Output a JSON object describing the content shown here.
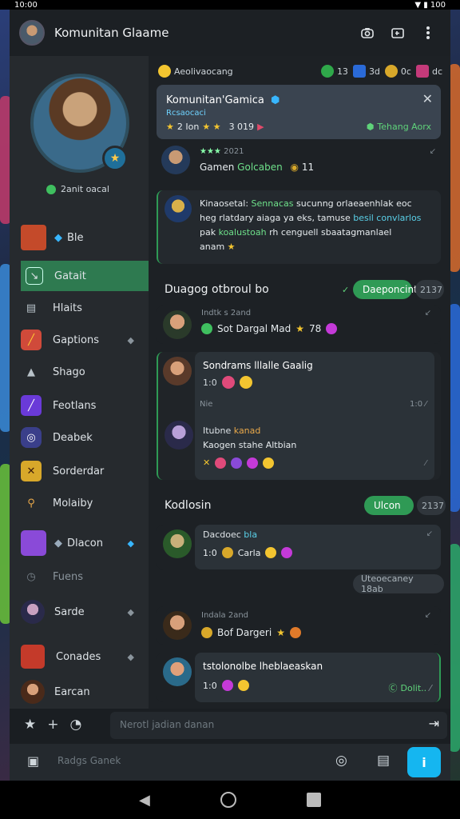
{
  "status_bar": {
    "time": "10:00",
    "battery": "100"
  },
  "header": {
    "title": "Komunitan Glaame"
  },
  "profile": {
    "status_text": "2anit oacal"
  },
  "sidebar": {
    "items": [
      {
        "label": "Ble",
        "icon": "diamond-icon"
      },
      {
        "label": "Gatait",
        "icon": "chat-icon"
      },
      {
        "label": "Hlaits",
        "icon": "cards-icon"
      },
      {
        "label": "Gaptions",
        "icon": "sword-icon"
      },
      {
        "label": "Shago",
        "icon": "pyramid-icon"
      },
      {
        "label": "Feotlans",
        "icon": "quill-icon"
      },
      {
        "label": "Deabek",
        "icon": "game-icon"
      },
      {
        "label": "Sorderdar",
        "icon": "crossed-swords-icon"
      },
      {
        "label": "Molaiby",
        "icon": "magnifier-icon"
      },
      {
        "label": "Dlacon",
        "icon": "gem-icon"
      },
      {
        "label": "Fuens",
        "icon": "clock-icon"
      },
      {
        "label": "Sarde",
        "icon": "avatar-icon"
      },
      {
        "label": "Conades",
        "icon": "cards-icon"
      },
      {
        "label": "Earcan",
        "icon": "avatar-icon"
      }
    ]
  },
  "main": {
    "top_chips": {
      "label": "Aeolivaocang",
      "c1": "13",
      "c2": "3d",
      "c3": "0c",
      "c4": "dc"
    },
    "group_card": {
      "name": "Komunitan'Gamica",
      "sub": "Rcsaocaci",
      "rating": "2 Ion",
      "count": "3 019",
      "tag": "Tehang Aorx"
    },
    "m1": {
      "stars": "2021",
      "text": "Gamen",
      "highlight": "Golcaben",
      "count": "11"
    },
    "m2": {
      "lead": "Kinaosetal:",
      "hl1": "Sennacas",
      "rest1": "sucunng orlaeaenhlak eoc",
      "line2": "heg rlatdary aiaga ya eks, tamuse",
      "hl2": "besil convlarlos",
      "line3a": "pak",
      "hl3": "koalustoah",
      "line3b": "rh cenguell sbaatagmanlael",
      "line4": "anam"
    },
    "section1": {
      "title": "Duagog otbroul bo",
      "bubble": "Daeponcint",
      "time": "2137"
    },
    "m3": {
      "meta": "Indtk s 2and",
      "text": "Sot Dargal Mad",
      "count": "78"
    },
    "m4": {
      "title": "Sondrams lllalle Gaalig",
      "nums": "1:0",
      "meta1": "Nie",
      "meta2": "1:0"
    },
    "m5": {
      "name": "Itubne",
      "hl": "kanad",
      "text": "Kaogen stahe Altbian"
    },
    "section2": {
      "title": "Kodlosin",
      "bubble": "Ulcon",
      "time": "2137"
    },
    "m6": {
      "name": "Dacdoec",
      "tag": "bla",
      "nums": "1:0",
      "text": "Carla"
    },
    "timepill": "Uteoecaney 18ab",
    "m7": {
      "meta": "Indala 2and",
      "text": "Bof Dargeri"
    },
    "m8": {
      "title": "tstolonolbe lheblaeaskan",
      "nums": "1:0",
      "time": "Dolit.."
    }
  },
  "composer": {
    "placeholder": "Nerotl jadian danan",
    "search": "Radgs Ganek"
  },
  "colors": {
    "accent": "#2f9a55",
    "send": "#15b6f0"
  }
}
